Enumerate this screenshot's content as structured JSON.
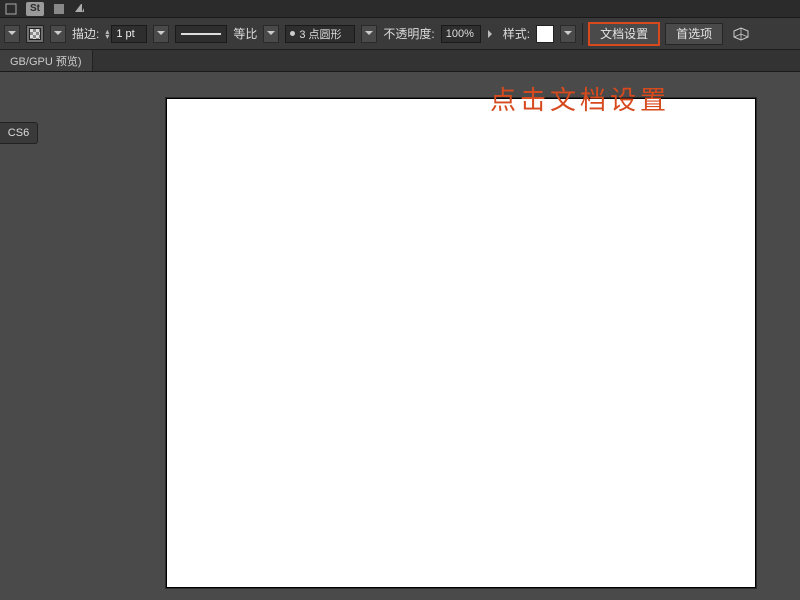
{
  "menubar": {
    "st_label": "St"
  },
  "controlbar": {
    "stroke_label": "描边:",
    "stroke_weight": "1 pt",
    "uniform_label": "等比",
    "profile_label": "3 点圆形",
    "opacity_label": "不透明度:",
    "opacity_value": "100%",
    "style_label": "样式:",
    "doc_setup_label": "文档设置",
    "prefs_label": "首选项"
  },
  "tabstrip": {
    "doc_tab": "GB/GPU 预览)"
  },
  "workspace": {
    "panel_tab": "CS6",
    "annotation": "点击文档设置"
  }
}
